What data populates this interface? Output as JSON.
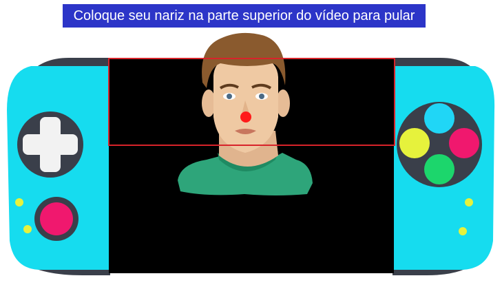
{
  "instruction": {
    "text": "Coloque seu nariz na parte superior do vídeo para pular"
  },
  "colors": {
    "console_body": "#16dcef",
    "console_shoulder": "#3a3f4a",
    "dpad": "#f2f2f2",
    "button_magenta": "#f0186e",
    "button_cyan": "#20d6f6",
    "button_yellow": "#e6f23c",
    "button_pink": "#f0186e",
    "button_green": "#1cd66c",
    "indicator_lights": "#e6f23c",
    "banner": "#2c35c8",
    "target_zone": "#d8232a",
    "nose_marker": "#ff1a1a",
    "video_background": "#000000"
  },
  "icons": {
    "dpad": "dpad-icon",
    "face_buttons": "face-buttons-icon",
    "analog_button": "round-button-icon",
    "nose_tracker": "nose-marker-icon"
  }
}
